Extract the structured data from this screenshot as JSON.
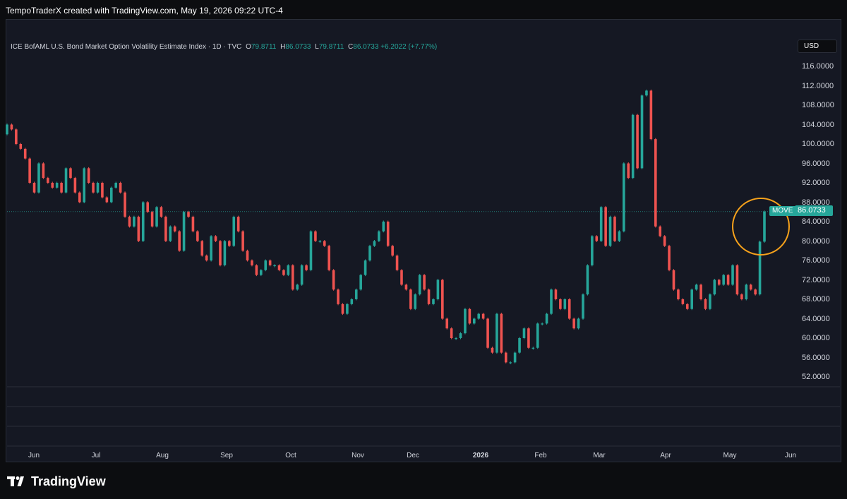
{
  "header": {
    "caption": "TempoTraderX created with TradingView.com, May 19, 2026 09:22 UTC-4"
  },
  "legend": {
    "symbol": "ICE BofAML U.S. Bond Market Option Volatility Estimate Index · 1D · TVC",
    "open_label": "O",
    "open_value": "79.8711",
    "high_label": "H",
    "high_value": "86.0733",
    "low_label": "L",
    "low_value": "79.8711",
    "close_label": "C",
    "close_value": "86.0733",
    "change": "+6.2022 (+7.77%)"
  },
  "currency_button": "USD",
  "last_price": {
    "symbol_tag": "MOVE",
    "value_tag": "86.0733"
  },
  "brand": {
    "name": "TradingView"
  },
  "colors": {
    "up": "#26a69a",
    "down": "#ef5350",
    "highlight_circle": "#f7a21b",
    "background": "#151823"
  },
  "chart_data": {
    "type": "candlestick",
    "ylim": [
      50,
      118
    ],
    "price_ticks": [
      "116.0000",
      "112.0000",
      "108.0000",
      "104.0000",
      "100.0000",
      "96.0000",
      "92.0000",
      "88.0000",
      "84.0000",
      "80.0000",
      "76.0000",
      "72.0000",
      "68.0000",
      "64.0000",
      "60.0000",
      "56.0000",
      "52.0000"
    ],
    "time_labels": [
      {
        "label": "Jun",
        "bold": false
      },
      {
        "label": "Jul",
        "bold": false
      },
      {
        "label": "Aug",
        "bold": false
      },
      {
        "label": "Sep",
        "bold": false
      },
      {
        "label": "Oct",
        "bold": false
      },
      {
        "label": "Nov",
        "bold": false
      },
      {
        "label": "Dec",
        "bold": false
      },
      {
        "label": "2026",
        "bold": true
      },
      {
        "label": "Feb",
        "bold": false
      },
      {
        "label": "Mar",
        "bold": false
      },
      {
        "label": "Apr",
        "bold": false
      },
      {
        "label": "May",
        "bold": false
      },
      {
        "label": "Jun",
        "bold": false
      }
    ],
    "last_close": 86.0733,
    "closes": [
      104,
      103,
      100,
      99,
      97,
      92,
      90,
      96,
      93,
      92,
      91,
      92,
      90,
      95,
      93,
      90,
      88,
      95,
      92,
      90,
      92,
      89,
      88,
      91,
      92,
      90,
      85,
      83,
      85,
      80,
      88,
      86,
      83,
      87,
      85,
      80,
      83,
      82,
      78,
      86,
      85,
      82,
      80,
      77,
      76,
      81,
      80,
      75,
      80,
      79,
      85,
      82,
      78,
      76,
      75,
      73,
      74,
      76,
      75,
      75,
      74,
      73,
      75,
      70,
      71,
      75,
      74,
      82,
      80,
      80,
      79,
      74,
      70,
      67,
      65,
      67,
      68,
      70,
      73,
      76,
      79,
      80,
      82,
      84,
      79,
      77,
      74,
      71,
      70,
      66,
      69,
      73,
      70,
      67,
      68,
      72,
      64,
      62,
      60,
      60,
      61,
      66,
      63,
      64,
      65,
      64,
      58,
      57,
      65,
      57,
      55,
      55,
      57,
      60,
      62,
      58,
      58,
      63,
      63,
      65,
      70,
      68,
      66,
      68,
      64,
      62,
      64,
      69,
      75,
      81,
      80,
      87,
      79,
      85,
      80,
      82,
      96,
      93,
      106,
      95,
      110,
      111,
      101,
      83,
      81,
      79,
      74,
      70,
      68,
      67,
      66,
      70,
      71,
      68,
      66,
      69,
      72,
      71,
      73,
      71,
      75,
      69,
      68,
      71,
      70,
      69,
      79.8711,
      86.0733
    ]
  }
}
